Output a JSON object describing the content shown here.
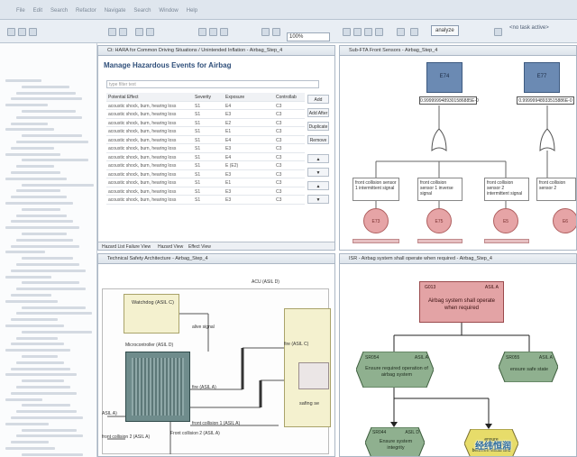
{
  "menu": [
    "File",
    "Edit",
    "Search",
    "Refactor",
    "Navigate",
    "Search",
    "Window",
    "Help"
  ],
  "toolbar": {
    "zoom": "100%",
    "analyze": "analyze",
    "task": "<no task active>"
  },
  "hazard_editor": {
    "tab": "Ct: HARA for Common Driving Situations / Unintended Inflation - Airbag_Step_4",
    "title": "Manage Hazardous Events for Airbag",
    "filter_placeholder": "type filter text",
    "columns": [
      "Potential Effect",
      "Severity",
      "Exposure",
      "Controllab"
    ],
    "rows": [
      [
        "acoustic shock, burn, hearing loss",
        "S1",
        "E4",
        "C3"
      ],
      [
        "acoustic shock, burn, hearing loss",
        "S1",
        "E3",
        "C3"
      ],
      [
        "acoustic shock, burn, hearing loss",
        "S1",
        "E2",
        "C3"
      ],
      [
        "acoustic shock, burn, hearing loss",
        "S1",
        "E1",
        "C3"
      ],
      [
        "acoustic shock, burn, hearing loss",
        "S1",
        "E4",
        "C3"
      ],
      [
        "acoustic shock, burn, hearing loss",
        "S1",
        "E3",
        "C3"
      ],
      [
        "acoustic shock, burn, hearing loss",
        "S1",
        "E4",
        "C3"
      ],
      [
        "acoustic shock, burn, hearing loss",
        "S1",
        "E (E2)",
        "C3"
      ],
      [
        "acoustic shock, burn, hearing loss",
        "S1",
        "E3",
        "C3"
      ],
      [
        "acoustic shock, burn, hearing loss",
        "S1",
        "E1",
        "C3"
      ],
      [
        "acoustic shock, burn, hearing loss",
        "S1",
        "E3",
        "C3"
      ],
      [
        "acoustic shock, burn, hearing loss",
        "S1",
        "E3",
        "C3"
      ]
    ],
    "buttons": [
      "Add",
      "Add After",
      "Duplicate",
      "Remove"
    ],
    "bottom_tabs": [
      "Hazard List Failure View",
      "Hazard View",
      "Effect View"
    ]
  },
  "fta": {
    "tab": "Sub-FTA Front Sensors - Airbag_Step_4",
    "events": [
      "E74",
      "E77"
    ],
    "values": [
      "0.9999999489301586885E-0",
      "0.99999948933515886E-0"
    ],
    "texts": [
      "front collision sensor 1 intermittent signal",
      "front collision sensor 1 inverse signal",
      "front collision sensor 2 intermittent signal",
      "front collision sensor 2"
    ],
    "circles": [
      "E73",
      "E75",
      "E5",
      "E6"
    ]
  },
  "arch": {
    "tab": "Technical Safety Architecture - Airbag_Step_4",
    "acu": "ACU (ASIL D)",
    "watchdog": "Watchdog (ASIL C)",
    "alive": "alive signal",
    "mcu": "Microcontroller (ASIL D)",
    "fire": "fire (ASIL C)",
    "fire2": "fire (ASIL A)",
    "safing": "safing se",
    "sensor": "front collision 2 (ASIL A)",
    "sensor2": "ASIL A)",
    "sensor3": "Front collision 2 (ASIL A)",
    "sensor4": "front collision 1 (ASIL A)"
  },
  "gsn": {
    "tab": "ISR - Airbag system shall operate when required - Airbag_Step_4",
    "goal_id": "G013",
    "goal_asil": "ASIL A",
    "goal_text": "Airbag system shall operate when required",
    "s1_id": "SR054",
    "s1_asil": "ASIL A",
    "s1_text": "Ensure required operation of airbag system",
    "s2_id": "SR055",
    "s2_asil": "ASIL A",
    "s2_text": "ensure safe state",
    "s3_id": "SR044",
    "s3_asil": "ASIL D",
    "s3_text": "Ensure system integrity",
    "s4_text": "ensure independence between visual and",
    "watermark": "经纬恒润"
  }
}
